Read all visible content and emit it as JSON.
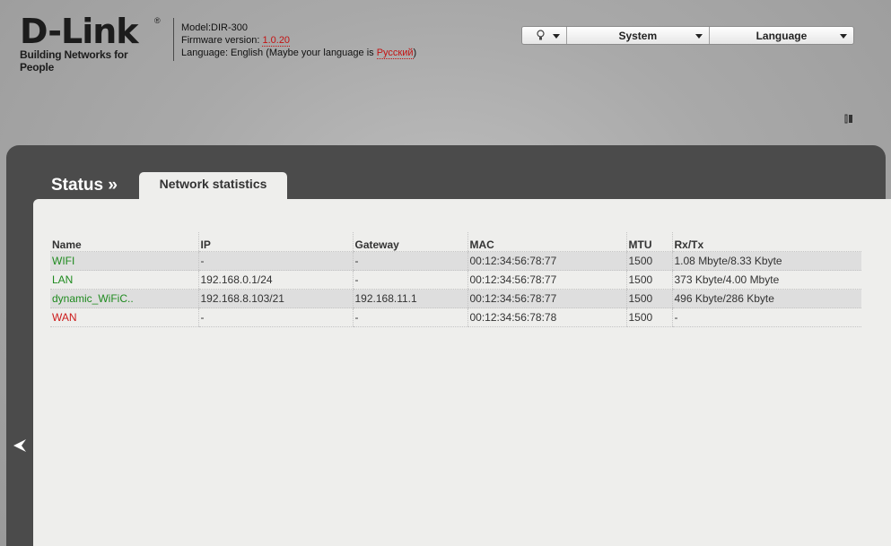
{
  "brand": {
    "logo": "D-Link",
    "registered": "®",
    "tagline": "Building Networks for People"
  },
  "device": {
    "model": "Model:DIR-300",
    "firmware_label": "Firmware version: ",
    "firmware_value": "1.0.20",
    "language_prefix": "Language: English (Maybe your language is ",
    "language_link": "Русский",
    "language_suffix": ")"
  },
  "toolbar": {
    "tips_icon": "lightbulb-icon",
    "system_label": "System",
    "language_label": "Language"
  },
  "page": {
    "section": "Status »",
    "tab": "Network statistics"
  },
  "table": {
    "headers": [
      "Name",
      "IP",
      "Gateway",
      "MAC",
      "MTU",
      "Rx/Tx"
    ],
    "rows": [
      {
        "name": "WIFI",
        "name_color": "green",
        "ip": "-",
        "gateway": "-",
        "mac": "00:12:34:56:78:77",
        "mtu": "1500",
        "rxtx": "1.08 Mbyte/8.33 Kbyte"
      },
      {
        "name": "LAN",
        "name_color": "green",
        "ip": "192.168.0.1/24",
        "gateway": "-",
        "mac": "00:12:34:56:78:77",
        "mtu": "1500",
        "rxtx": "373 Kbyte/4.00 Mbyte"
      },
      {
        "name": "dynamic_WiFiC..",
        "name_color": "green",
        "ip": "192.168.8.103/21",
        "gateway": "192.168.11.1",
        "mac": "00:12:34:56:78:77",
        "mtu": "1500",
        "rxtx": "496 Kbyte/286 Kbyte"
      },
      {
        "name": "WAN",
        "name_color": "red",
        "ip": "-",
        "gateway": "-",
        "mac": "00:12:34:56:78:78",
        "mtu": "1500",
        "rxtx": "-"
      }
    ]
  },
  "colors": {
    "accent_red": "#c41212",
    "status_green": "#1e8a1e",
    "panel_dark": "#4b4b4b"
  }
}
